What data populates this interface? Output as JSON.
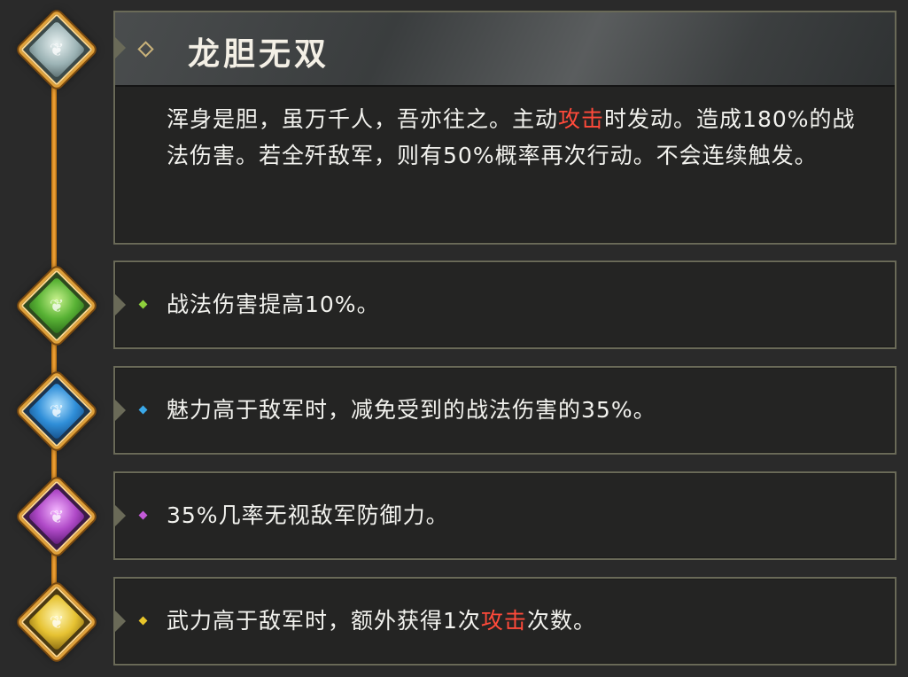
{
  "skill": {
    "title": "龙胆无双",
    "description_parts": [
      {
        "text": "浑身是胆，虽万千人，吾亦往之。主动",
        "highlight": false
      },
      {
        "text": "攻击",
        "highlight": true
      },
      {
        "text": "时发动。造成180%的战法伤害。若全歼敌军，则有50%概率再次行动。不会连续触发。",
        "highlight": false
      }
    ]
  },
  "upgrades": [
    {
      "gem": "green-gem-icon",
      "color": "#8fd13c",
      "parts": [
        {
          "text": "战法伤害提高10%。",
          "highlight": false
        }
      ]
    },
    {
      "gem": "blue-gem-icon",
      "color": "#3aa8e8",
      "parts": [
        {
          "text": "魅力高于敌军时，减免受到的战法伤害的35%。",
          "highlight": false
        }
      ]
    },
    {
      "gem": "purple-gem-icon",
      "color": "#c35ad8",
      "parts": [
        {
          "text": "35%几率无视敌军防御力。",
          "highlight": false
        }
      ]
    },
    {
      "gem": "gold-gem-icon",
      "color": "#e8c52a",
      "parts": [
        {
          "text": "武力高于敌军时，额外获得1次",
          "highlight": false
        },
        {
          "text": "攻击",
          "highlight": true
        },
        {
          "text": "次数。",
          "highlight": false
        }
      ]
    }
  ],
  "colors": {
    "highlight": "#ff4a3a",
    "frame": "#6a6a58",
    "timeline": "#f2a53a"
  }
}
